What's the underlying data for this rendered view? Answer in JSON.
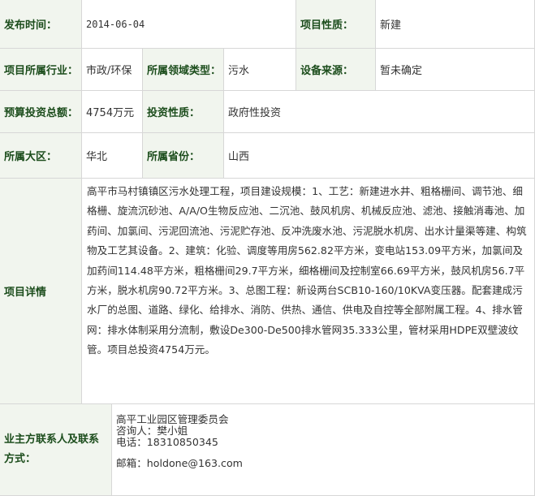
{
  "rows": {
    "publish_time": {
      "label": "发布时间：",
      "value": "2014-06-04"
    },
    "project_nature": {
      "label": "项目性质：",
      "value": "新建"
    },
    "industry": {
      "label": "项目所属行业：",
      "value": "市政/环保"
    },
    "field_type": {
      "label": "所属领域类型：",
      "value": "污水"
    },
    "equipment_source": {
      "label": "设备来源：",
      "value": "暂未确定"
    },
    "budget": {
      "label": "预算投资总额：",
      "value": "4754万元"
    },
    "investment_nature": {
      "label": "投资性质：",
      "value": "政府性投资"
    },
    "region": {
      "label": "所属大区：",
      "value": "华北"
    },
    "province": {
      "label": "所属省份：",
      "value": "山西"
    }
  },
  "details": {
    "label": "项目详情",
    "text": "高平市马村镇镇区污水处理工程，项目建设规模：1、工艺：新建进水井、粗格栅间、调节池、细格栅、旋流沉砂池、A/A/O生物反应池、二沉池、鼓风机房、机械反应池、滤池、接触消毒池、加药间、加氯间、污泥回流池、污泥贮存池、反冲洗废水池、污泥脱水机房、出水计量渠等建、构筑物及工艺其设备。2、建筑：化验、调度等用房562.82平方米，变电站153.09平方米，加氯间及加药间114.48平方米，粗格栅间29.7平方米，细格栅间及控制室66.69平方米，鼓风机房56.7平方米，脱水机房90.72平方米。3、总图工程：新设两台SCB10-160/10KVA变压器。配套建成污水厂的总图、道路、绿化、给排水、消防、供热、通信、供电及自控等全部附属工程。4、排水管网：排水体制采用分流制，敷设De300-De500排水管网35.333公里，管材采用HDPE双壁波纹管。项目总投资4754万元。"
  },
  "contact": {
    "label": "业主方联系人及联系方式：",
    "organization": "高平工业园区管理委员会",
    "consultant": "咨询人：樊小姐",
    "phone": "电话：18310850345",
    "email": "邮箱：holdone@163.com"
  }
}
